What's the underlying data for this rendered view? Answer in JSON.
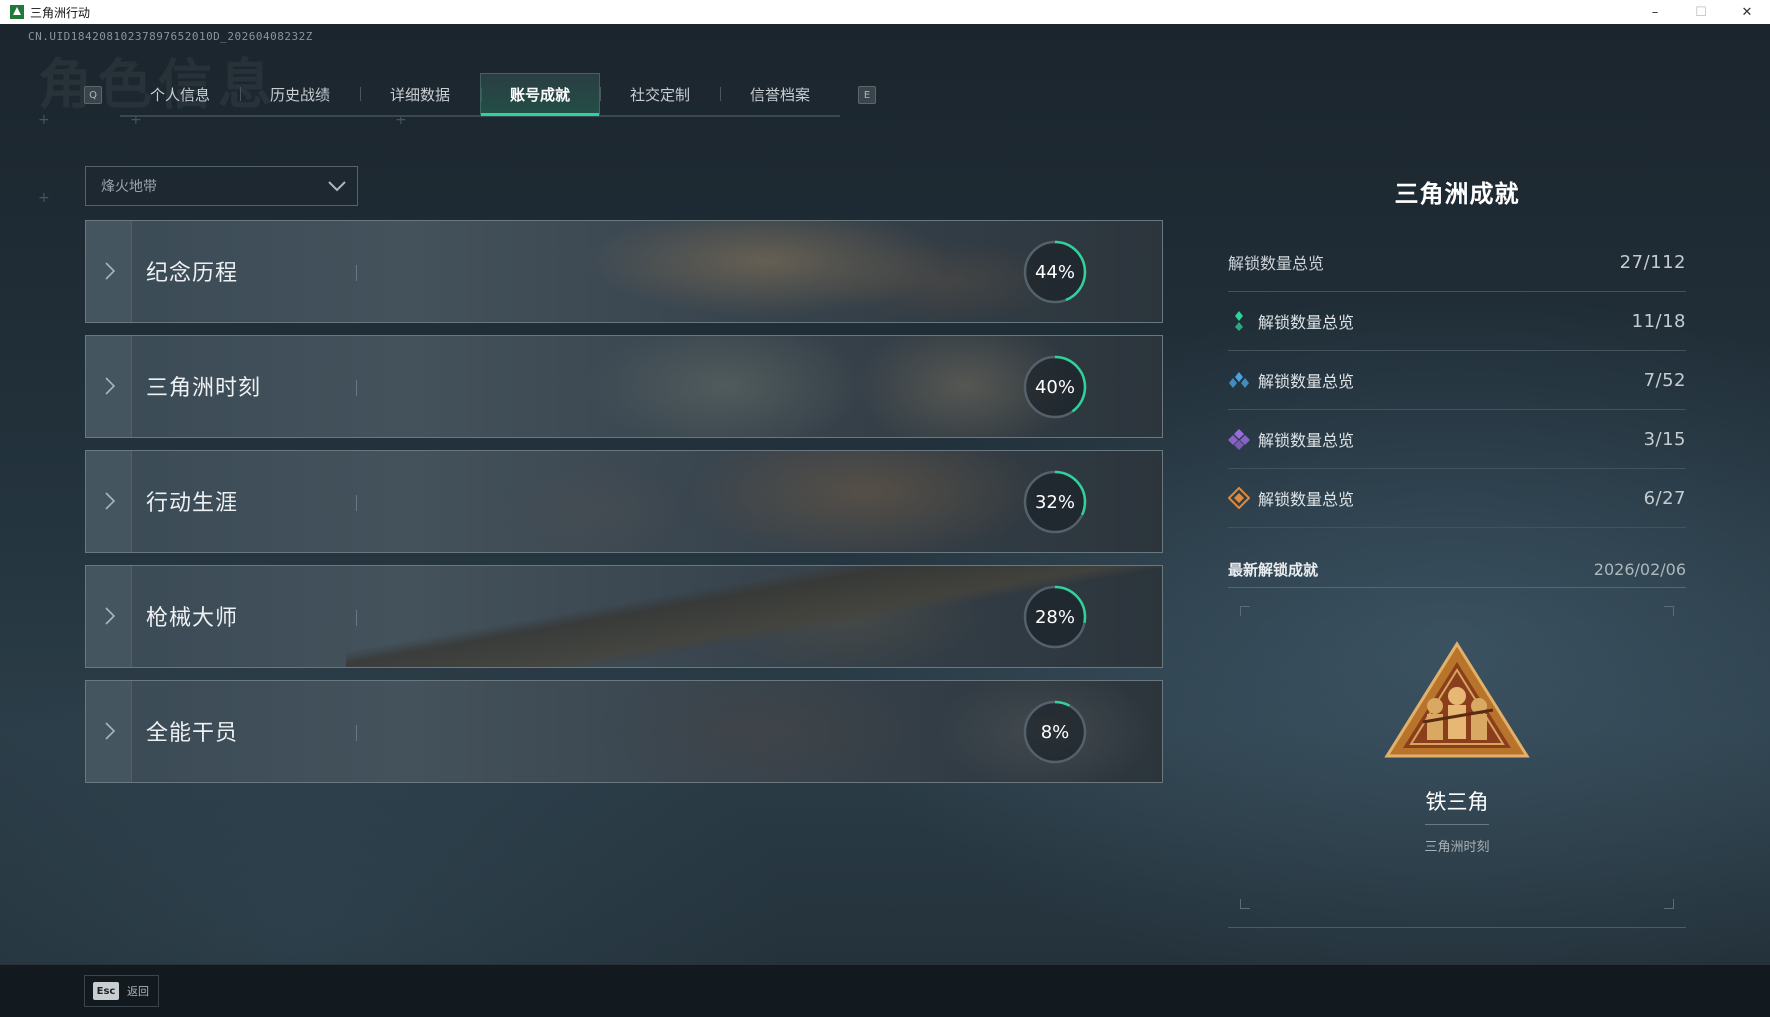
{
  "window": {
    "title": "三角洲行动",
    "min_glyph": "–",
    "max_glyph": "☐",
    "close_glyph": "✕"
  },
  "header": {
    "uid": "CN.UID18420810237897652010D_20260408232Z",
    "bg_title": "角色信息"
  },
  "tabs": {
    "left_key": "Q",
    "right_key": "E",
    "items": [
      {
        "label": "个人信息"
      },
      {
        "label": "历史战绩"
      },
      {
        "label": "详细数据"
      },
      {
        "label": "账号成就",
        "active": true
      },
      {
        "label": "社交定制"
      },
      {
        "label": "信誉档案"
      }
    ]
  },
  "filter": {
    "selected": "烽火地带"
  },
  "categories": [
    {
      "name": "纪念历程",
      "percent": 44,
      "percent_label": "44%"
    },
    {
      "name": "三角洲时刻",
      "percent": 40,
      "percent_label": "40%"
    },
    {
      "name": "行动生涯",
      "percent": 32,
      "percent_label": "32%"
    },
    {
      "name": "枪械大师",
      "percent": 28,
      "percent_label": "28%"
    },
    {
      "name": "全能干员",
      "percent": 8,
      "percent_label": "8%"
    }
  ],
  "summary": {
    "title": "三角洲成就",
    "rows": [
      {
        "label": "解锁数量总览",
        "value": "27/112",
        "icon": "none"
      },
      {
        "label": "解锁数量总览",
        "value": "11/18",
        "icon": "green-tier-icon",
        "color": "#2fd29a"
      },
      {
        "label": "解锁数量总览",
        "value": "7/52",
        "icon": "blue-tier-icon",
        "color": "#4aa3e0"
      },
      {
        "label": "解锁数量总览",
        "value": "3/15",
        "icon": "purple-tier-icon",
        "color": "#9b6be0"
      },
      {
        "label": "解锁数量总览",
        "value": "6/27",
        "icon": "orange-tier-icon",
        "color": "#e08a3a"
      }
    ]
  },
  "latest": {
    "label": "最新解锁成就",
    "date": "2026/02/06",
    "achievement_name": "铁三角",
    "achievement_category": "三角洲时刻"
  },
  "bottom": {
    "esc_key": "Esc",
    "back_label": "返回"
  },
  "colors": {
    "accent": "#2fd29a",
    "ring_track": "#55616a"
  }
}
